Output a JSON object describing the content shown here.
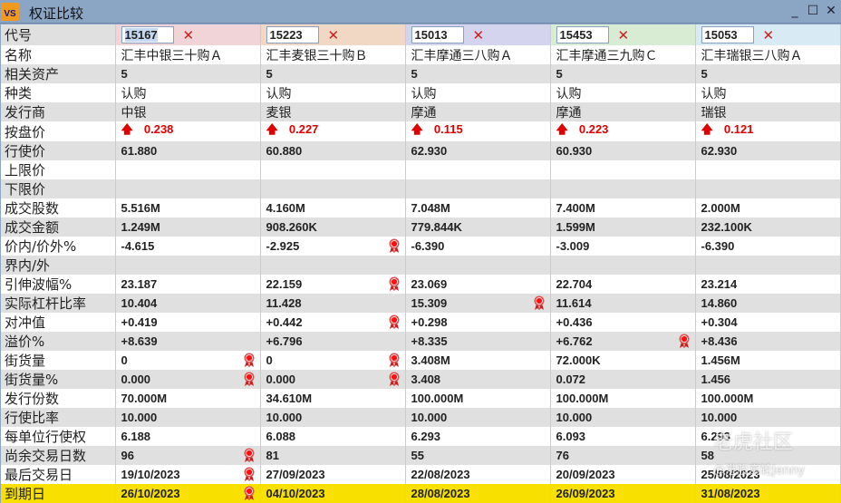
{
  "window": {
    "title": "权证比较",
    "app_icon": "VS"
  },
  "header_colors": [
    "#f0d4d8",
    "#f0d8c4",
    "#d4d4ee",
    "#d8ecd4",
    "#d8eaf4"
  ],
  "codes": [
    "15167",
    "15223",
    "15013",
    "15453",
    "15053"
  ],
  "rows": [
    {
      "label": "名称",
      "type": "txt",
      "values": [
        "汇丰中银三十购Ａ",
        "汇丰麦银三十购Ｂ",
        "汇丰摩通三八购Ａ",
        "汇丰摩通三九购Ｃ",
        "汇丰瑞银三八购Ａ"
      ],
      "awards": [
        0,
        0,
        0,
        0,
        0
      ]
    },
    {
      "label": "相关资产",
      "type": "val",
      "values": [
        "5",
        "5",
        "5",
        "5",
        "5"
      ],
      "awards": [
        0,
        0,
        0,
        0,
        0
      ]
    },
    {
      "label": "种类",
      "type": "txt",
      "values": [
        "认购",
        "认购",
        "认购",
        "认购",
        "认购"
      ],
      "awards": [
        0,
        0,
        0,
        0,
        0
      ]
    },
    {
      "label": "发行商",
      "type": "txt",
      "values": [
        "中银",
        "麦银",
        "摩通",
        "摩通",
        "瑞银"
      ],
      "awards": [
        0,
        0,
        0,
        0,
        0
      ]
    },
    {
      "label": "按盘价",
      "type": "price",
      "values": [
        "0.238",
        "0.227",
        "0.115",
        "0.223",
        "0.121"
      ],
      "awards": [
        0,
        0,
        0,
        0,
        0
      ]
    },
    {
      "label": "行使价",
      "type": "val",
      "values": [
        "61.880",
        "60.880",
        "62.930",
        "60.930",
        "62.930"
      ],
      "awards": [
        0,
        0,
        0,
        0,
        0
      ]
    },
    {
      "label": "上限价",
      "type": "val",
      "values": [
        "",
        "",
        "",
        "",
        ""
      ],
      "awards": [
        0,
        0,
        0,
        0,
        0
      ]
    },
    {
      "label": "下限价",
      "type": "val",
      "values": [
        "",
        "",
        "",
        "",
        ""
      ],
      "awards": [
        0,
        0,
        0,
        0,
        0
      ]
    },
    {
      "label": "成交股数",
      "type": "val",
      "values": [
        "5.516M",
        "4.160M",
        "7.048M",
        "7.400M",
        "2.000M"
      ],
      "awards": [
        0,
        0,
        0,
        0,
        0
      ]
    },
    {
      "label": "成交金额",
      "type": "val",
      "values": [
        "1.249M",
        "908.260K",
        "779.844K",
        "1.599M",
        "232.100K"
      ],
      "awards": [
        0,
        0,
        0,
        0,
        0
      ]
    },
    {
      "label": "价内/价外%",
      "type": "val",
      "values": [
        "-4.615",
        "-2.925",
        "-6.390",
        "-3.009",
        "-6.390"
      ],
      "awards": [
        0,
        1,
        0,
        0,
        0
      ]
    },
    {
      "label": "界内/外",
      "type": "val",
      "values": [
        "",
        "",
        "",
        "",
        ""
      ],
      "awards": [
        0,
        0,
        0,
        0,
        0
      ]
    },
    {
      "label": "引伸波幅%",
      "type": "val",
      "values": [
        "23.187",
        "22.159",
        "23.069",
        "22.704",
        "23.214"
      ],
      "awards": [
        0,
        1,
        0,
        0,
        0
      ]
    },
    {
      "label": "实际杠杆比率",
      "type": "val",
      "values": [
        "10.404",
        "11.428",
        "15.309",
        "11.614",
        "14.860"
      ],
      "awards": [
        0,
        0,
        1,
        0,
        0
      ]
    },
    {
      "label": "对冲值",
      "type": "val",
      "values": [
        "+0.419",
        "+0.442",
        "+0.298",
        "+0.436",
        "+0.304"
      ],
      "awards": [
        0,
        1,
        0,
        0,
        0
      ]
    },
    {
      "label": "溢价%",
      "type": "val",
      "values": [
        "+8.639",
        "+6.796",
        "+8.335",
        "+6.762",
        "+8.436"
      ],
      "awards": [
        0,
        0,
        0,
        1,
        0
      ]
    },
    {
      "label": "街货量",
      "type": "val",
      "values": [
        "0",
        "0",
        "3.408M",
        "72.000K",
        "1.456M"
      ],
      "awards": [
        1,
        1,
        0,
        0,
        0
      ]
    },
    {
      "label": "街货量%",
      "type": "val",
      "values": [
        "0.000",
        "0.000",
        "3.408",
        "0.072",
        "1.456"
      ],
      "awards": [
        1,
        1,
        0,
        0,
        0
      ]
    },
    {
      "label": "发行份数",
      "type": "val",
      "values": [
        "70.000M",
        "34.610M",
        "100.000M",
        "100.000M",
        "100.000M"
      ],
      "awards": [
        0,
        0,
        0,
        0,
        0
      ]
    },
    {
      "label": "行使比率",
      "type": "val",
      "values": [
        "10.000",
        "10.000",
        "10.000",
        "10.000",
        "10.000"
      ],
      "awards": [
        0,
        0,
        0,
        0,
        0
      ]
    },
    {
      "label": "每单位行使权",
      "type": "val",
      "values": [
        "6.188",
        "6.088",
        "6.293",
        "6.093",
        "6.293"
      ],
      "awards": [
        0,
        0,
        0,
        0,
        0
      ]
    },
    {
      "label": "尚余交易日数",
      "type": "val",
      "values": [
        "96",
        "81",
        "55",
        "76",
        "58"
      ],
      "awards": [
        1,
        0,
        0,
        0,
        0
      ]
    },
    {
      "label": "最后交易日",
      "type": "val",
      "values": [
        "19/10/2023",
        "27/09/2023",
        "22/08/2023",
        "20/09/2023",
        "25/08/2023"
      ],
      "awards": [
        1,
        0,
        0,
        0,
        0
      ]
    },
    {
      "label": "到期日",
      "type": "val",
      "values": [
        "26/10/2023",
        "04/10/2023",
        "28/08/2023",
        "26/09/2023",
        "31/08/2023"
      ],
      "awards": [
        1,
        0,
        0,
        0,
        0
      ]
    }
  ],
  "code_label": "代号",
  "watermark": {
    "line1": "老虎社区",
    "line2": "@港股窝轮Jenny"
  }
}
